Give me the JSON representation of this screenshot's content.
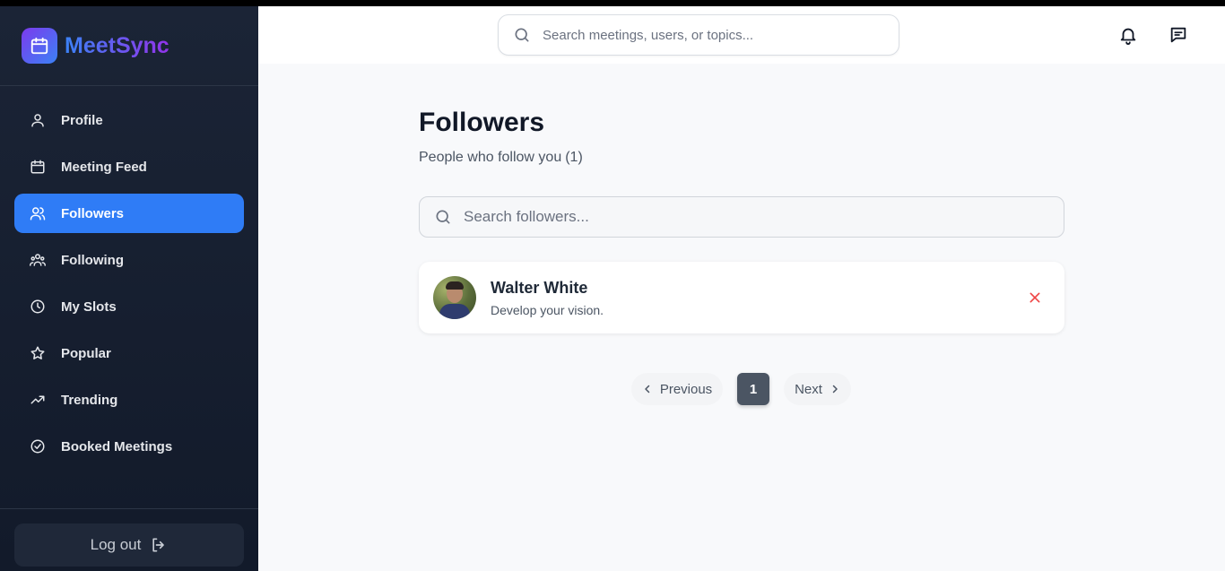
{
  "app": {
    "name": "MeetSync",
    "logo_icon": "calendar-icon"
  },
  "colors": {
    "accent": "#2f7cf6",
    "sidebar_bg": "#1b2436",
    "remove": "#ef4444"
  },
  "sidebar": {
    "items": [
      {
        "label": "Profile",
        "icon": "user-icon",
        "active": false
      },
      {
        "label": "Meeting Feed",
        "icon": "calendar-icon",
        "active": false
      },
      {
        "label": "Followers",
        "icon": "users-icon",
        "active": true
      },
      {
        "label": "Following",
        "icon": "group-icon",
        "active": false
      },
      {
        "label": "My Slots",
        "icon": "clock-icon",
        "active": false
      },
      {
        "label": "Popular",
        "icon": "star-icon",
        "active": false
      },
      {
        "label": "Trending",
        "icon": "trending-up-icon",
        "active": false
      },
      {
        "label": "Booked Meetings",
        "icon": "check-circle-icon",
        "active": false
      }
    ],
    "logout_label": "Log out"
  },
  "topbar": {
    "search_placeholder": "Search meetings, users, or topics...",
    "icons": [
      "bell-icon",
      "message-icon"
    ]
  },
  "main": {
    "title": "Followers",
    "subtitle": "People who follow you",
    "count": "(1)",
    "search_placeholder": "Search followers...",
    "followers": [
      {
        "name": "Walter White",
        "bio": "Develop your vision."
      }
    ],
    "pagination": {
      "prev_label": "Previous",
      "next_label": "Next",
      "current_page": "1"
    }
  }
}
